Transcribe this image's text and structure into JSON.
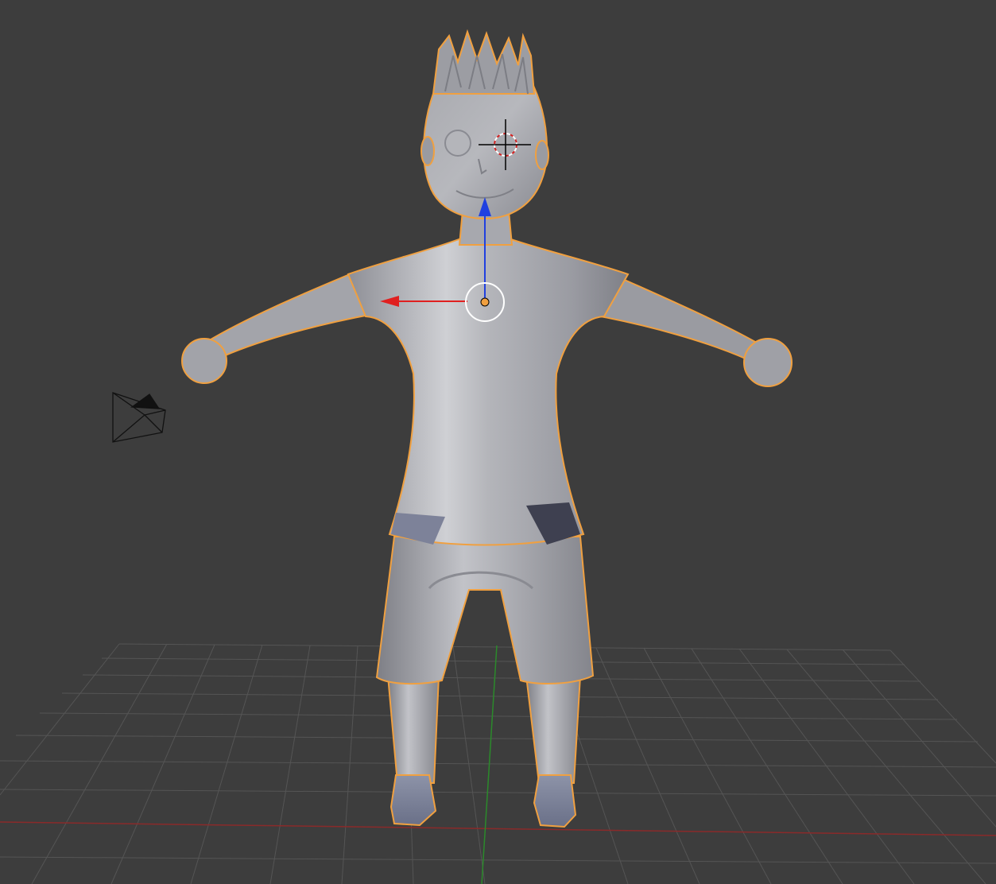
{
  "viewport": {
    "background_color": "#3d3d3d",
    "grid_line_color": "#555555",
    "x_axis_color": "#8a2a2a",
    "y_axis_color": "#2b8a2b",
    "selection_outline_color": "#f0a040",
    "gizmo_x_color": "#e02020",
    "gizmo_z_color": "#2040e0",
    "mesh_base_color": "#9a9ba3"
  },
  "objects": {
    "character": {
      "name_icon": "character-mesh",
      "selected": true
    },
    "camera": {
      "name_icon": "camera-icon"
    },
    "cursor": {
      "name_icon": "3d-cursor-icon"
    },
    "gizmo": {
      "name_icon": "transform-gizmo-icon"
    }
  }
}
